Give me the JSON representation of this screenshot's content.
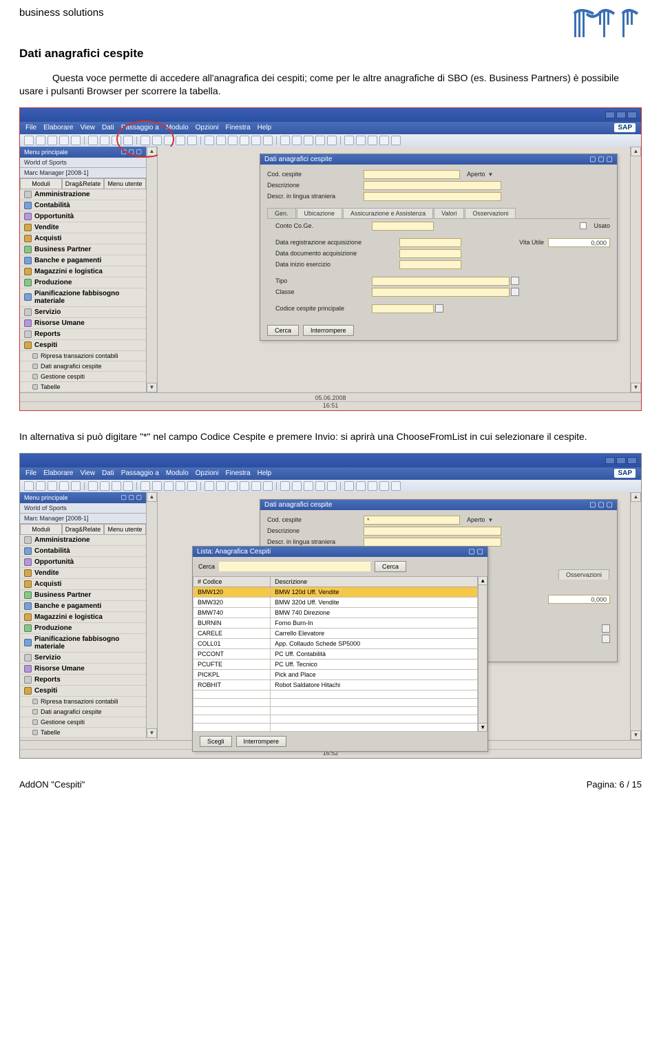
{
  "doc": {
    "header": "business solutions",
    "title": "Dati anagrafici cespite",
    "paragraph1": "Questa voce permette di accedere all'anagrafica dei cespiti; come per le altre anagrafiche di SBO (es. Business Partners) è possibile usare i pulsanti Browser per scorrere la tabella.",
    "paragraph2": "In alternativa si può digitare \"*\" nel campo Codice Cespite e premere Invio: si aprirà una ChooseFromList in cui selezionare il cespite.",
    "footer_left": "AddON \"Cespiti\"",
    "footer_right": "Pagina: 6 / 15"
  },
  "app": {
    "menu": [
      "File",
      "Elaborare",
      "View",
      "Dati",
      "Passaggio a",
      "Modulo",
      "Opzioni",
      "Finestra",
      "Help"
    ],
    "sap": "SAP",
    "side_title": "Menu principale",
    "company": "World of Sports",
    "user_line": "Marc Manager   [2008-1]",
    "side_tabs": [
      "Moduli",
      "Drag&Relate",
      "Menu utente"
    ],
    "modules": [
      {
        "label": "Amministrazione",
        "ico": "grey"
      },
      {
        "label": "Contabilità",
        "ico": "blue"
      },
      {
        "label": "Opportunità",
        "ico": "purple"
      },
      {
        "label": "Vendite",
        "ico": ""
      },
      {
        "label": "Acquisti",
        "ico": ""
      },
      {
        "label": "Business Partner",
        "ico": "green"
      },
      {
        "label": "Banche e pagamenti",
        "ico": "blue"
      },
      {
        "label": "Magazzini e logistica",
        "ico": ""
      },
      {
        "label": "Produzione",
        "ico": "green"
      },
      {
        "label": "Pianificazione fabbisogno materiale",
        "ico": "blue"
      },
      {
        "label": "Servizio",
        "ico": "grey"
      },
      {
        "label": "Risorse Umane",
        "ico": "purple"
      },
      {
        "label": "Reports",
        "ico": "grey"
      },
      {
        "label": "Cespiti",
        "ico": ""
      }
    ],
    "sub_items": [
      "Ripresa transazioni contabili",
      "Dati anagrafici cespite",
      "Gestione cespiti",
      "Tabelle"
    ],
    "status_date": "05.06.2008",
    "status_time1": "16:51",
    "status_time2": "16:52"
  },
  "panel1": {
    "title": "Dati anagrafici cespite",
    "fields": {
      "cod": "Cod. cespite",
      "desc": "Descrizione",
      "desc_lang": "Descr. in lingua straniera",
      "status": "Aperto"
    },
    "tabs": [
      "Gen.",
      "Ubicazione",
      "Assicurazione e Assistenza",
      "Valori",
      "Osservazioni"
    ],
    "details": {
      "conto": "Conto Co.Ge.",
      "usato": "Usato",
      "data_reg": "Data registrazione acquisizione",
      "vita": "Vita Utile",
      "vita_val": "0,000",
      "data_doc": "Data documento acquisizione",
      "data_esc": "Data inizio esercizio",
      "tipo": "Tipo",
      "classe": "Classe",
      "codice_princ": "Codice cespite principale"
    },
    "buttons": {
      "search": "Cerca",
      "cancel": "Interrompere"
    }
  },
  "panel2": {
    "title": "Dati anagrafici cespite",
    "list_title": "Lista: Anagrafica Cespiti",
    "search_label": "Cerca",
    "search_btn": "Cerca",
    "cols": {
      "code": "# Codice",
      "desc": "Descrizione"
    },
    "rows": [
      {
        "code": "BMW120",
        "desc": "BMW 120d Uff. Vendite",
        "hl": true
      },
      {
        "code": "BMW320",
        "desc": "BMW 320d Uff. Vendite"
      },
      {
        "code": "BMW740",
        "desc": "BMW 740 Direzione"
      },
      {
        "code": "BURNIN",
        "desc": "Forno Burn-In"
      },
      {
        "code": "CARELE",
        "desc": "Carrello Elevatore"
      },
      {
        "code": "COLL01",
        "desc": "App. Collaudo Schede SP5000"
      },
      {
        "code": "PCCONT",
        "desc": "PC Uff. Contabilità"
      },
      {
        "code": "PCUFTE",
        "desc": "PC Uff. Tecnico"
      },
      {
        "code": "PICKPL",
        "desc": "Pick and Place"
      },
      {
        "code": "ROBHIT",
        "desc": "Robot Saldatore Hitachi"
      }
    ],
    "buttons": {
      "choose": "Scegli",
      "cancel": "Interrompere"
    },
    "vita_val": "0,000",
    "tab_obs": "Osservazioni"
  }
}
